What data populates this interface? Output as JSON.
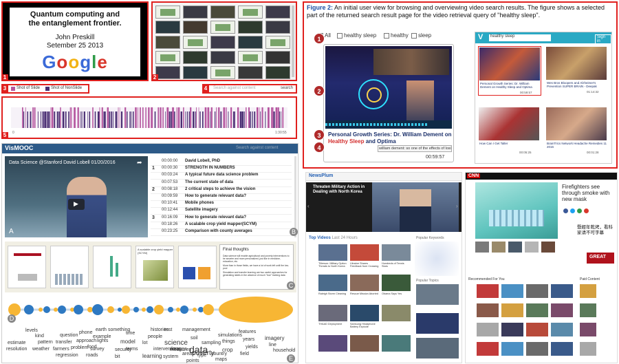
{
  "panel_top_left": {
    "slide_title_line1": "Quantum computing and",
    "slide_title_line2": "the entanglement frontier.",
    "slide_author": "John Preskill",
    "slide_date": "Setember 25 2013",
    "slide_logo": "Google",
    "legend_slide": "Shot of Slide",
    "legend_nonslide": "Shot of NonSlide",
    "search_placeholder": "Search against content",
    "search_button": "search",
    "timeline_start": "0",
    "timeline_end": "1:30:55",
    "badges": [
      "1",
      "2",
      "3",
      "4",
      "5"
    ]
  },
  "caption": {
    "label": "Figure 2:",
    "text": "An initial user view for browsing and overviewing video search results. The figure shows a selected part of the returned search result page for the video retrieval query of \"healthy sleep\"."
  },
  "search_result": {
    "filters": [
      "All",
      "healthy sleep",
      "healthy",
      "sleep"
    ],
    "search_value": "healthy sleep",
    "signin": "Sign in",
    "player_title_a": "Personal Growth Series: Dr. William Dement on ",
    "player_title_hl1": "Healthy Sleep",
    "player_title_b": " and Optima",
    "player_subtitle": "william dement: so one of the effects of losing sleep is",
    "player_time": "00:59:57",
    "badges": [
      "1",
      "2",
      "3",
      "4"
    ],
    "result_titles": [
      "Personal Growth Series: Dr. William Dement on Healthy Sleep and Optima",
      "Wes Bros Bloopers and Alzheimer's Prevention SUPER BRAIN - Deepak",
      "How Can I Get Taller",
      "BrainTrics Network Headache Remedies 11 2016"
    ],
    "result_times": [
      "00:59:57",
      "01:14:32",
      "00:05:25",
      "00:01:28"
    ]
  },
  "vismooc": {
    "app_title": "VisMOOC",
    "search_placeholder": "Search against content",
    "video_title": "Data Science @Stanford David Lobell 01/20/2016",
    "toc": [
      {
        "time": "00:00:00",
        "text": "David Lobell, PhD",
        "num": ""
      },
      {
        "time": "00:00:30",
        "text": "STRENGTH IN NUMBERS",
        "num": "1"
      },
      {
        "time": "00:03:24",
        "text": "A typical future data science problem",
        "num": ""
      },
      {
        "time": "00:07:53",
        "text": "The current state of data",
        "num": ""
      },
      {
        "time": "00:08:18",
        "text": "2 critical steps to achieve the vision",
        "num": "2"
      },
      {
        "time": "00:09:59",
        "text": "How to generate relevant data?",
        "num": ""
      },
      {
        "time": "00:10:41",
        "text": "Mobile phones",
        "num": ""
      },
      {
        "time": "00:12:44",
        "text": "Satellite imagery",
        "num": ""
      },
      {
        "time": "00:16:09",
        "text": "How to generate relevant data?",
        "num": "3"
      },
      {
        "time": "00:18:26",
        "text": "A scalable crop yield mapper(SCYM)",
        "num": ""
      },
      {
        "time": "00:23:25",
        "text": "Comparison with county averages",
        "num": ""
      }
    ],
    "slide_final_title": "Final thoughts",
    "slide_final_bullets": [
      "Data science will enable agricultural and poverty interventions to be smarter and more personalized, just like in medicine, education, etc.",
      "More than in those fields, we have a lot of work left until the low-pool",
      "Simulation and transfer learning are two useful approaches for generating labels in the absence of much \"true\" training data"
    ],
    "slide2_title": "A scalable crop yield mapper (SCYM)",
    "panel_labels": [
      "A",
      "B",
      "C",
      "D",
      "E"
    ],
    "wordcloud": [
      "levels",
      "kind",
      "question",
      "phone",
      "earth",
      "example",
      "something",
      "time",
      "histories",
      "test",
      "management",
      "people",
      "soil",
      "sampling",
      "simulations",
      "features",
      "things",
      "years",
      "imagery",
      "line",
      "estimate",
      "pattern",
      "transfer",
      "approach",
      "food",
      "lights",
      "model",
      "lot",
      "science",
      "data",
      "poverty",
      "crop",
      "yields",
      "household",
      "resolution",
      "weather",
      "farmers",
      "problem",
      "survey",
      "terms",
      "interventions",
      "images",
      "areas",
      "country",
      "field",
      "learning",
      "measures",
      "type",
      "security",
      "regression",
      "roads",
      "bit",
      "system",
      "points",
      "maps"
    ]
  },
  "news_left": {
    "brand": "NewsPlum",
    "headline": "Threaten Military Action in Dealing with North Korea",
    "section_top": "Top Videos",
    "section_top2": "Last 24 Hours",
    "popular_keywords": "Popular Keywords",
    "popular_topics": "Popular Topics",
    "captions": [
      "Tillerson: Military Option Threats to North Korea",
      "Ukraine Shares Feedback from Crossing",
      "Hundreds of Tennis Stars",
      "Raleigh Storm Cleaning",
      "Rescue Mission Aborted",
      "Obama Says Yes",
      "THAAD Deployment",
      "Samsung Headphone Battery Explode"
    ]
  },
  "news_right": {
    "brand": "CNN",
    "headline": "Firefighters see through smoke with new mask",
    "chinese_text": "暨經年乾烤，看科家请不可字幕",
    "recommended": "Recommended For You",
    "paid_content": "Paid Content",
    "great_label": "GREAT"
  }
}
